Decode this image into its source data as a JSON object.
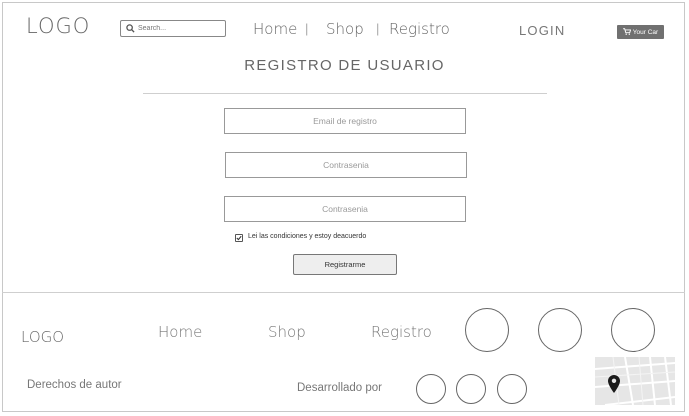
{
  "header": {
    "logo": "LOGO",
    "search_placeholder": "Search...",
    "nav": [
      {
        "label": "Home"
      },
      {
        "label": "Shop"
      },
      {
        "label": "Registro"
      }
    ],
    "separator": "|",
    "login": "LOGIN",
    "cart_label": "Your Car"
  },
  "form": {
    "title": "REGISTRO DE USUARIO",
    "fields": [
      {
        "placeholder": "Email de registro"
      },
      {
        "placeholder": "Contrasenia"
      },
      {
        "placeholder": "Contrasenia"
      }
    ],
    "checkbox_label": "Lei las condiciones y estoy deacuerdo",
    "checkbox_checked": true,
    "submit_label": "Registrarme"
  },
  "footer": {
    "logo": "LOGO",
    "nav": [
      {
        "label": "Home"
      },
      {
        "label": "Shop"
      },
      {
        "label": "Registro"
      }
    ],
    "copyright": "Derechos de autor",
    "developed_by": "Desarrollado por"
  },
  "colors": {
    "cart_bg": "#707070",
    "border": "#999999",
    "map_bg": "#e6e6e6"
  }
}
